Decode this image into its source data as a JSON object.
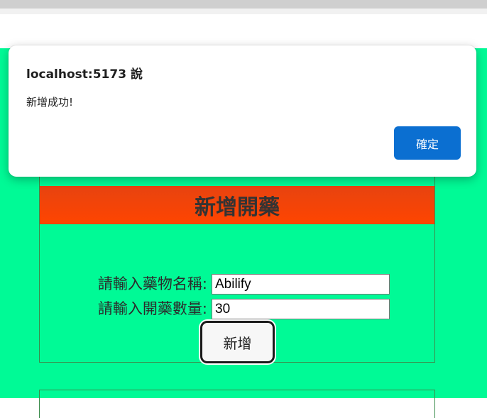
{
  "alert": {
    "origin": "localhost:5173 說",
    "message": "新增成功!",
    "ok_label": "確定"
  },
  "form": {
    "title": "新增開藥",
    "drug_name_label": "請輸入藥物名稱:",
    "drug_name_value": "Abilify",
    "quantity_label": "請輸入開藥數量:",
    "quantity_value": "30",
    "submit_label": "新增"
  },
  "colors": {
    "page_background": "#00fa96",
    "header_background": "#ff4500",
    "alert_button": "#0b6fd1"
  }
}
